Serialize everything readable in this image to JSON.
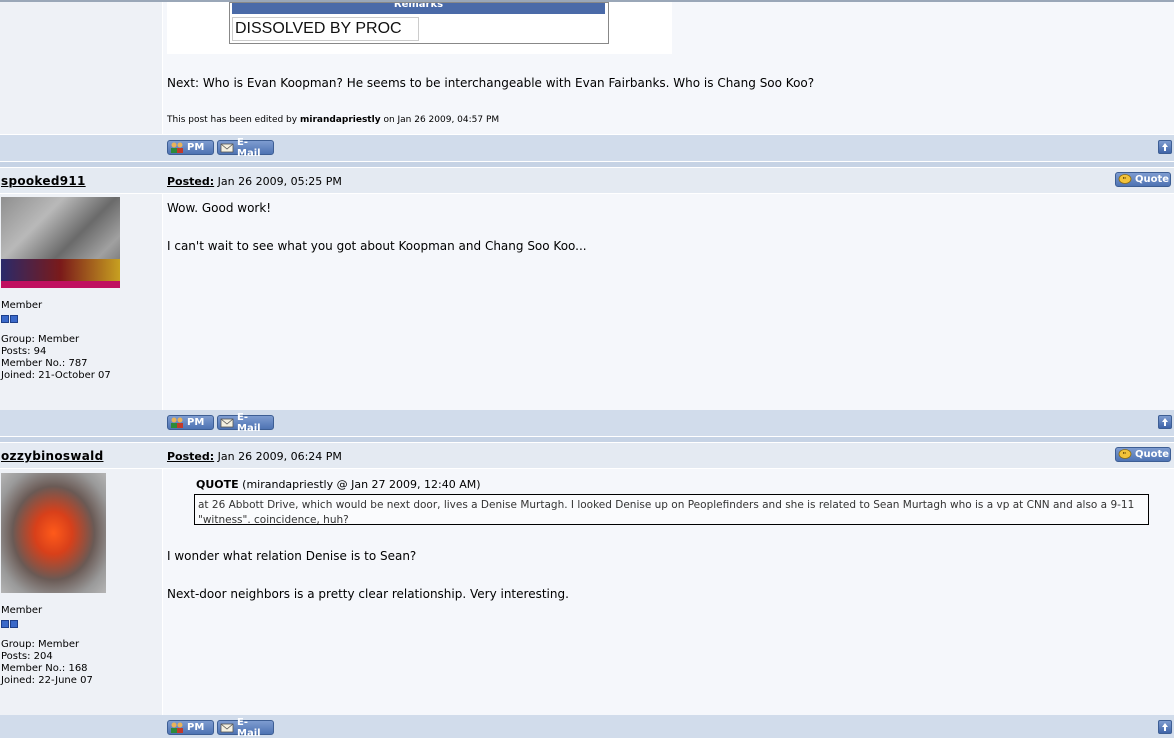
{
  "top_post": {
    "remarks_header": "Remarks",
    "remarks_value": "DISSOLVED BY PROC",
    "body_line": "Next: Who is Evan Koopman? He seems to be interchangeable with Evan Fairbanks. Who is Chang Soo Koo?",
    "edit_prefix": "This post has been edited by",
    "edit_user": "mirandapriestly",
    "edit_suffix": "on Jan 26 2009, 04:57 PM"
  },
  "buttons": {
    "pm": "PM",
    "email": "E-Mail",
    "quote": "Quote"
  },
  "posts": [
    {
      "username": "spooked911",
      "posted_label": "Posted:",
      "posted_date": "Jan 26 2009, 05:25 PM",
      "rank": "Member",
      "group": "Group: Member",
      "posts": "Posts: 94",
      "member_no": "Member No.: 787",
      "joined": "Joined: 21-October 07",
      "line1": "Wow. Good work!",
      "line2": "I can't wait to see what you got about Koopman and Chang Soo Koo..."
    },
    {
      "username": "ozzybinoswald",
      "posted_label": "Posted:",
      "posted_date": "Jan 26 2009, 06:24 PM",
      "rank": "Member",
      "group": "Group: Member",
      "posts": "Posts: 204",
      "member_no": "Member No.: 168",
      "joined": "Joined: 22-June 07",
      "quote_label": "QUOTE",
      "quote_source": "(mirandapriestly @ Jan 27 2009, 12:40 AM)",
      "quote_text": "at 26 Abbott Drive, which would be next door, lives a Denise Murtagh. I looked Denise up on Peoplefinders and she is related to Sean Murtagh who is a vp at CNN and also a 9-11 \"witness\". coincidence, huh?",
      "line1": "I wonder what relation Denise is to Sean?",
      "line2": "Next-door neighbors is a pretty clear relationship. Very interesting."
    }
  ],
  "colors": {
    "accent": "#4e73b3",
    "header_bar": "#d1dceb",
    "left_panel": "#eef1f6"
  }
}
